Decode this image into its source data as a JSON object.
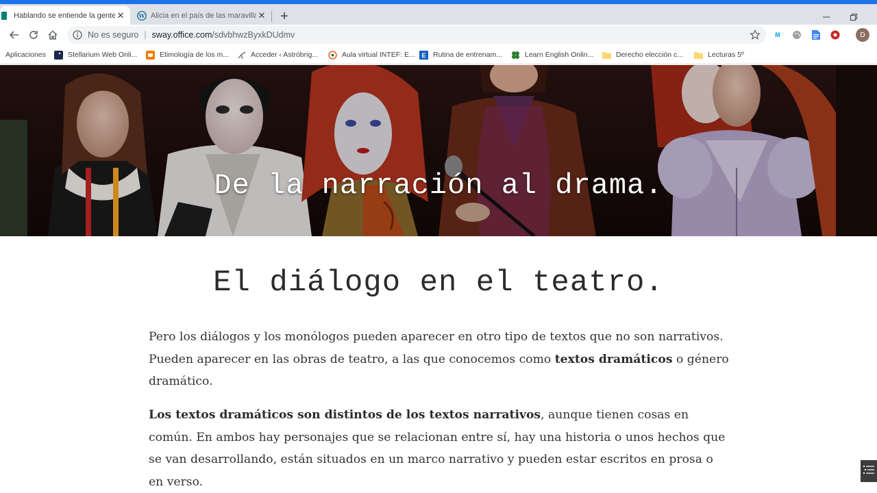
{
  "browser": {
    "tabs": [
      {
        "title": "Hablando se entiende la gente. D",
        "active": true,
        "favicon": "sway-icon"
      },
      {
        "title": "Alicia en el país de las maravillas",
        "active": false,
        "favicon": "wordpress-icon"
      }
    ],
    "address": {
      "security_text": "No es seguro",
      "separator": "|",
      "host": "sway.office.com",
      "path": "/sdvbhwzByxkDUdmv"
    },
    "profile_initial": "D",
    "extensions": [
      {
        "name": "movistar-icon",
        "label": "M"
      },
      {
        "name": "globe-extension-icon",
        "label": ""
      },
      {
        "name": "docs-extension-icon",
        "label": ""
      },
      {
        "name": "record-extension-icon",
        "label": ""
      }
    ],
    "bookmarks": [
      {
        "label": "Aplicaciones",
        "icon": "apps-icon"
      },
      {
        "label": "Stellarium Web Onli...",
        "icon": "stellarium-icon"
      },
      {
        "label": "Etimología de los m...",
        "icon": "blogger-icon"
      },
      {
        "label": "Acceder ‹ Astróbrig...",
        "icon": "telescope-icon"
      },
      {
        "label": "Aula virtual INTEF: E...",
        "icon": "intef-icon"
      },
      {
        "label": "Rutina de entrenam...",
        "icon": "e-icon"
      },
      {
        "label": "Learn English Onlin...",
        "icon": "clover-icon"
      },
      {
        "label": "Derecho elección c...",
        "icon": "folder-icon"
      },
      {
        "label": "Lecturas 5º",
        "icon": "folder-icon"
      }
    ],
    "colors": {
      "accent": "#1a73e8",
      "tabstrip": "#dee1e6",
      "omnibox": "#f1f3f4"
    }
  },
  "page": {
    "hero_title": "De la narración al drama.",
    "section_title": "El diálogo en el teatro.",
    "paragraph1": {
      "part1": "Pero los diálogos y los monólogos pueden aparecer en otro tipo de textos que no son narrativos. Pueden aparecer en las obras de teatro, a las que conocemos como ",
      "bold1": "textos dramáticos",
      "part2": " o género dramático."
    },
    "paragraph2": {
      "bold1": "Los textos dramáticos son distintos de los textos narrativos",
      "part1": ", aunque tienen cosas en común. En ambos hay personajes que se relacionan entre sí, hay una historia o unos hechos que se van desarrollando, están situados en un marco narrativo y pueden estar escritos en prosa o en verso."
    },
    "nav_toggle_icon": "list-icon"
  }
}
